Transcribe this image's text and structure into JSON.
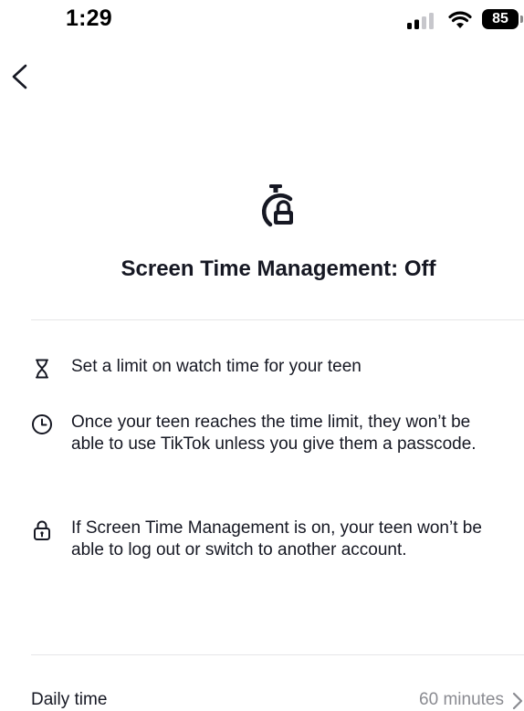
{
  "status_bar": {
    "time": "1:29",
    "battery": "85"
  },
  "header": {
    "back_icon": "chevron-left-icon"
  },
  "hero": {
    "icon": "stopwatch-lock-icon",
    "title": "Screen Time Management: Off"
  },
  "features": [
    {
      "icon": "hourglass-icon",
      "text": "Set a limit on watch time for your teen"
    },
    {
      "icon": "clock-icon",
      "text": "Once your teen reaches the time limit, they won’t be able to use TikTok unless you give them a passcode."
    },
    {
      "icon": "lock-icon",
      "text": "If Screen Time Management is on, your teen won’t be able to log out or switch to another account."
    }
  ],
  "daily_time": {
    "label": "Daily time",
    "value": "60 minutes"
  },
  "colors": {
    "text_primary": "#161823",
    "text_secondary": "#8a8b91",
    "divider": "#e6e6e8"
  }
}
